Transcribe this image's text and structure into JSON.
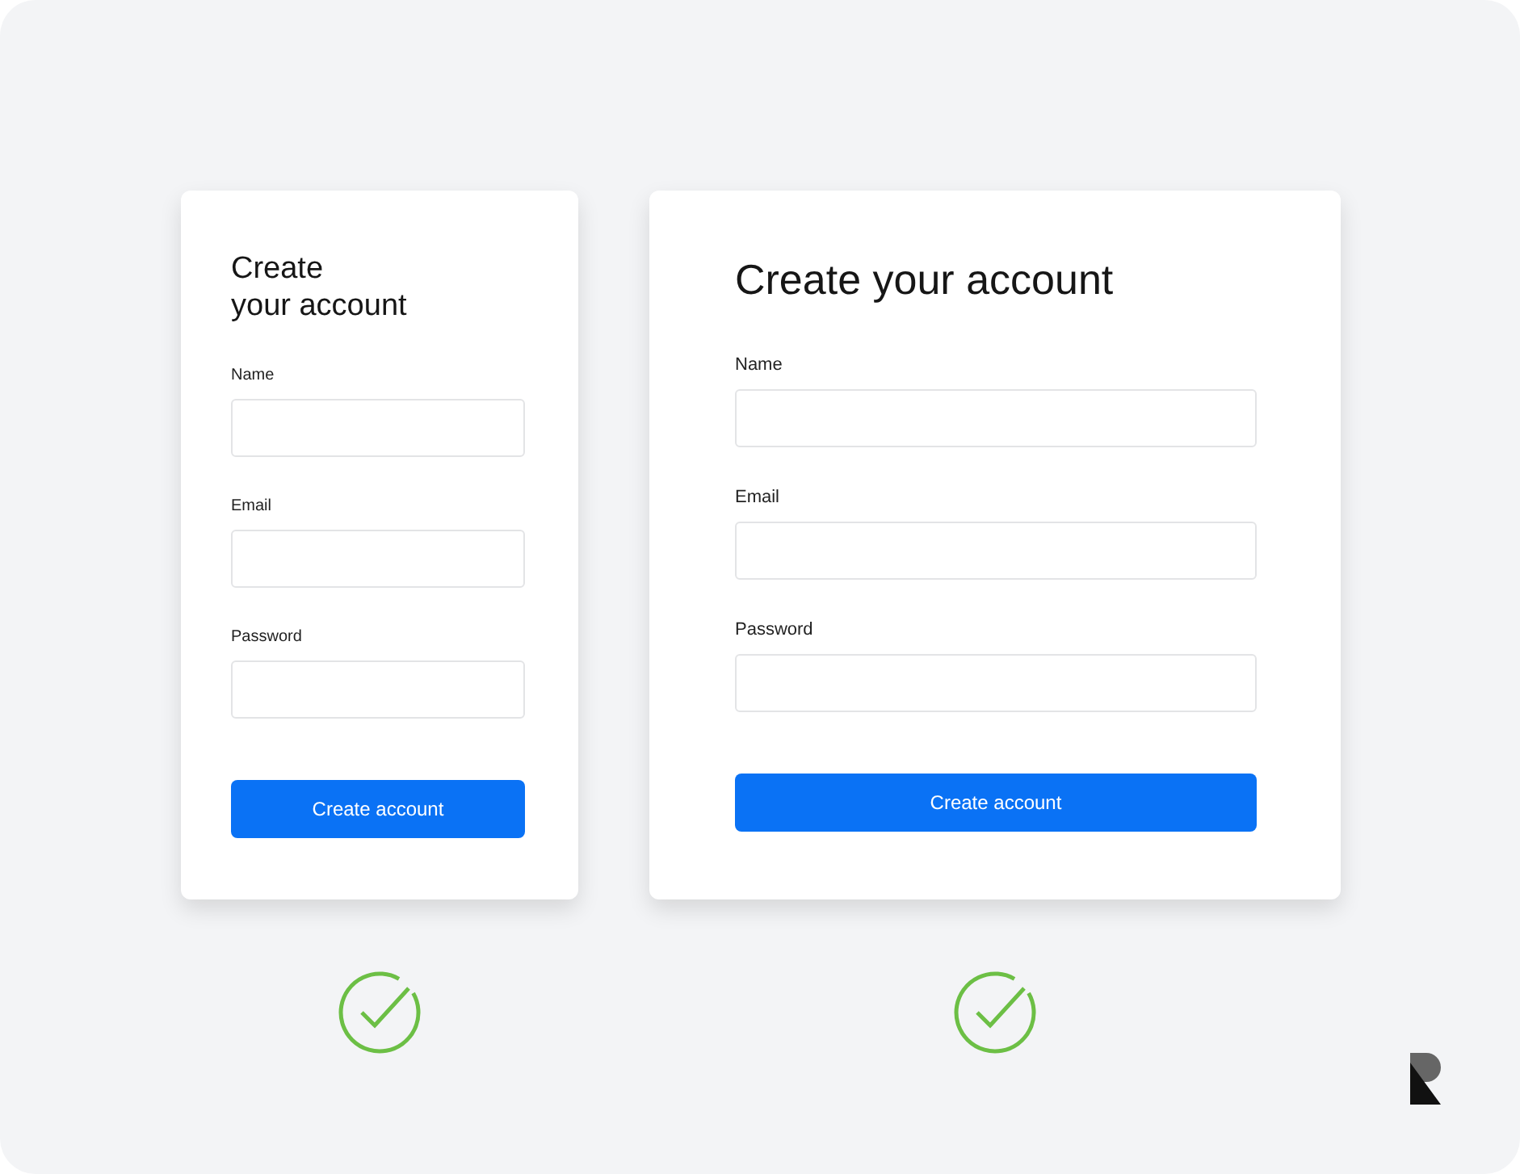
{
  "cards": [
    {
      "kind": "compact",
      "title_lines": [
        "Create",
        "your account"
      ],
      "fields": [
        {
          "label": "Name"
        },
        {
          "label": "Email"
        },
        {
          "label": "Password"
        }
      ],
      "button": "Create account"
    },
    {
      "kind": "wide",
      "title_lines": [
        "Create your account"
      ],
      "fields": [
        {
          "label": "Name"
        },
        {
          "label": "Email"
        },
        {
          "label": "Password"
        }
      ],
      "button": "Create account"
    }
  ]
}
